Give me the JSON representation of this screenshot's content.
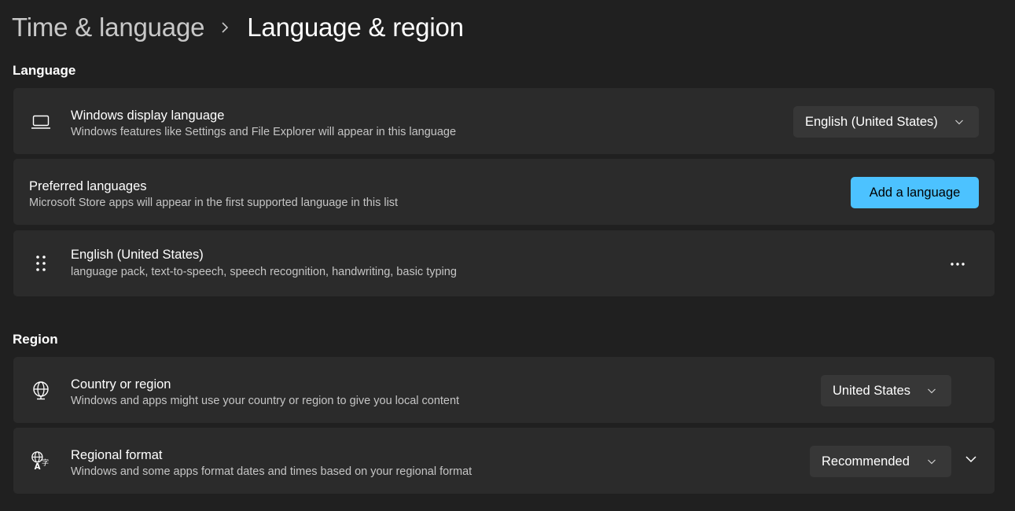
{
  "breadcrumb": {
    "parent": "Time & language",
    "separator_icon": "chevron-right-icon",
    "current": "Language & region"
  },
  "language_section": {
    "title": "Language",
    "display_language": {
      "icon": "laptop-icon",
      "title": "Windows display language",
      "description": "Windows features like Settings and File Explorer will appear in this language",
      "selected": "English (United States)"
    },
    "preferred_languages": {
      "title": "Preferred languages",
      "description": "Microsoft Store apps will appear in the first supported language in this list",
      "add_button": "Add a language"
    },
    "languages": [
      {
        "icon": "drag-handle-icon",
        "name": "English (United States)",
        "features": "language pack, text-to-speech, speech recognition, handwriting, basic typing",
        "more_icon": "more-options-icon"
      }
    ]
  },
  "region_section": {
    "title": "Region",
    "country": {
      "icon": "globe-icon",
      "title": "Country or region",
      "description": "Windows and apps might use your country or region to give you local content",
      "selected": "United States"
    },
    "regional_format": {
      "icon": "language-globe-icon",
      "title": "Regional format",
      "description": "Windows and some apps format dates and times based on your regional format",
      "selected": "Recommended",
      "expand_icon": "chevron-down-icon"
    }
  },
  "colors": {
    "background": "#202020",
    "card": "#2b2b2b",
    "control": "#373737",
    "accent": "#4cc2ff"
  }
}
